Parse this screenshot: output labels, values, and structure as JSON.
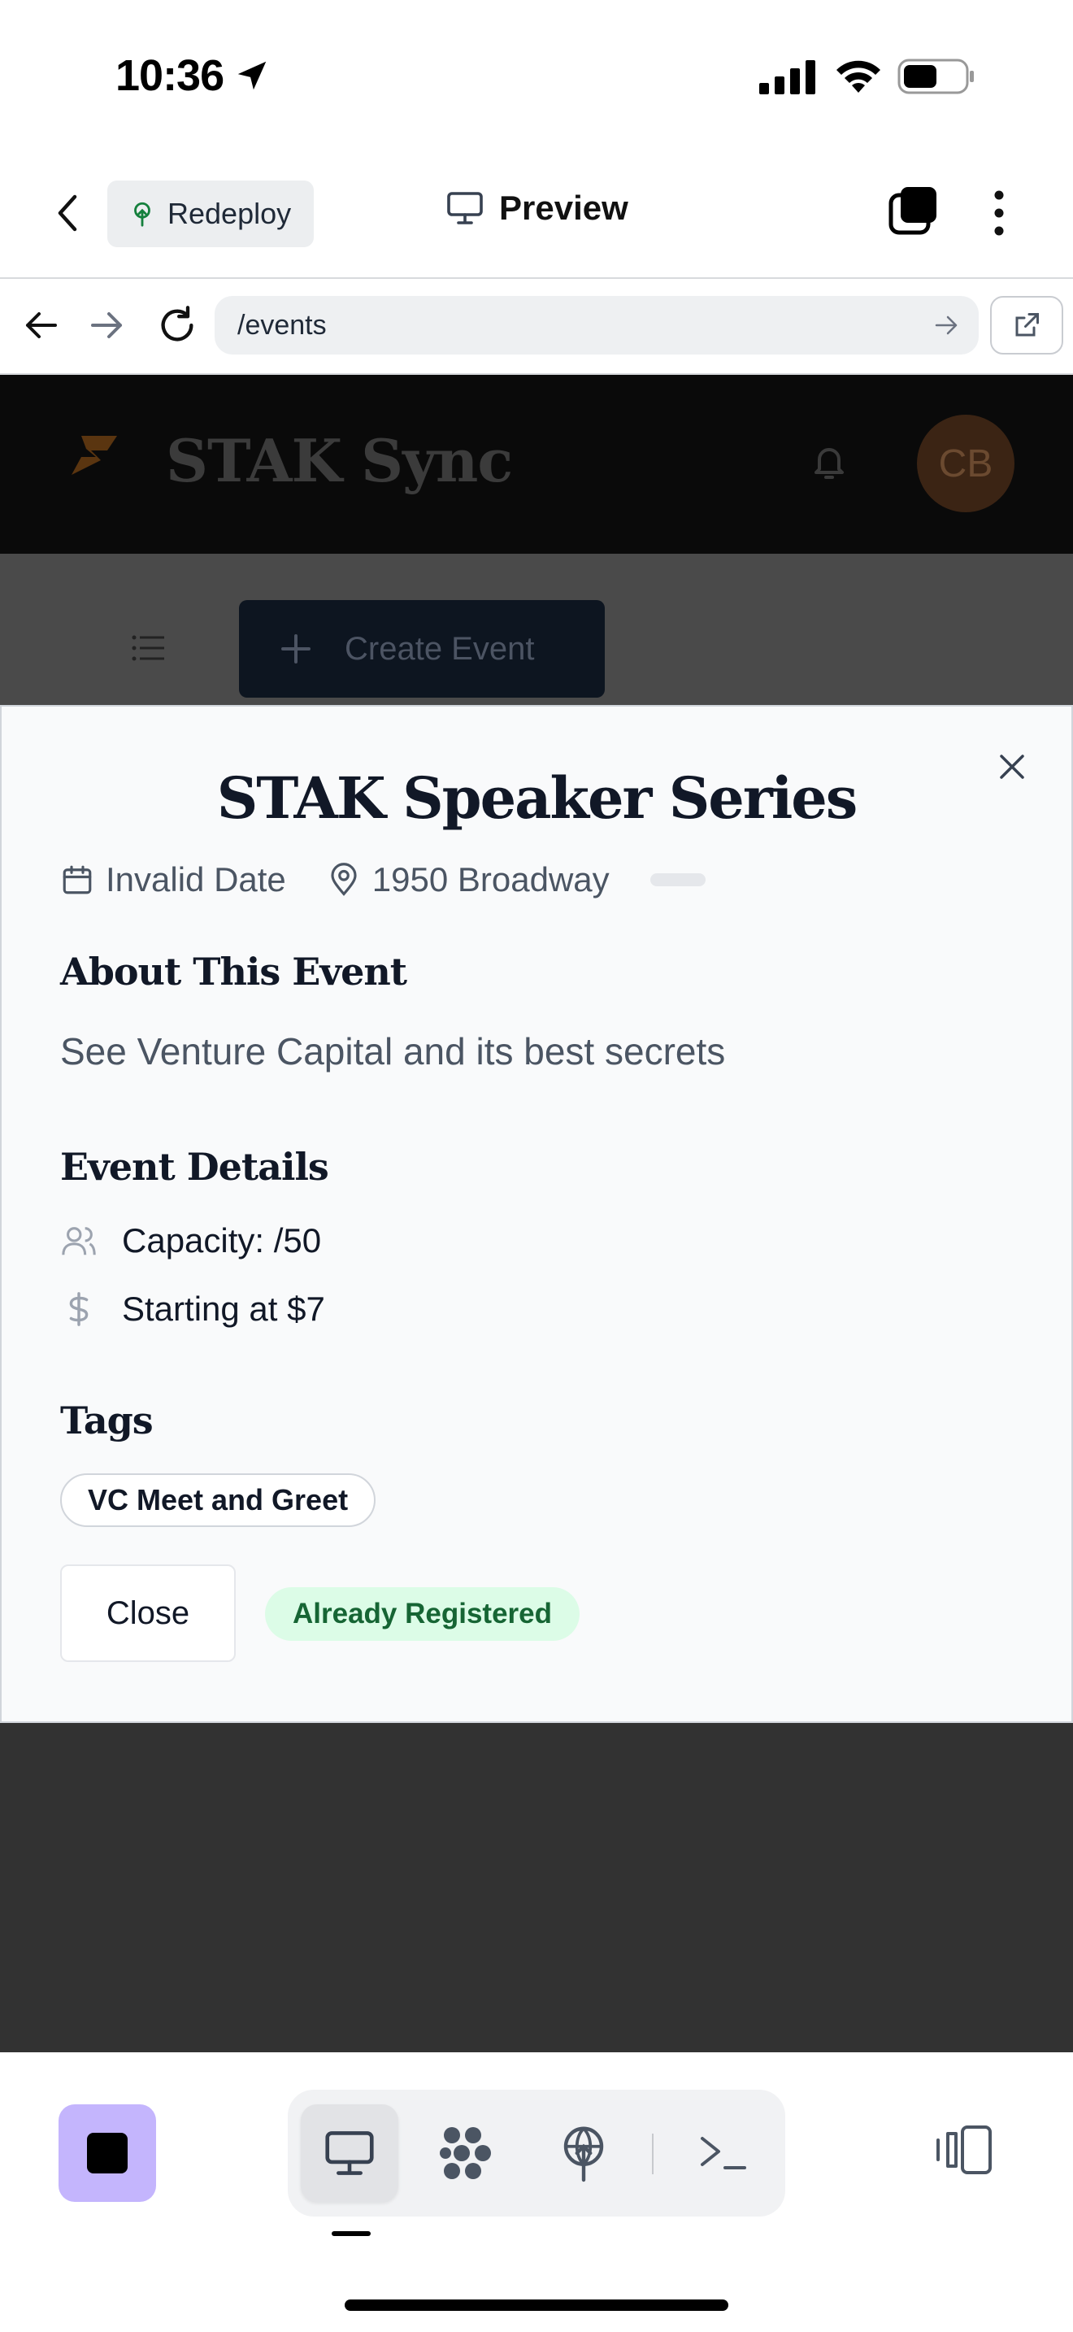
{
  "status_bar": {
    "time": "10:36"
  },
  "top_bar": {
    "redeploy_label": "Redeploy",
    "title": "Preview"
  },
  "address_bar": {
    "url": "/events"
  },
  "app": {
    "title": "STAK Sync",
    "avatar_initials": "CB",
    "create_event_label": "Create Event"
  },
  "modal": {
    "title": "STAK Speaker Series",
    "date": "Invalid Date",
    "location": "1950 Broadway",
    "about_heading": "About This Event",
    "about_text": "See Venture Capital and its best secrets",
    "details_heading": "Event Details",
    "capacity": "Capacity: /50",
    "price": "Starting at $7",
    "tags_heading": "Tags",
    "tags": [
      "VC Meet and Greet"
    ],
    "close_label": "Close",
    "registered_label": "Already Registered"
  },
  "colors": {
    "accent_purple": "#c4b5fd",
    "registered_bg": "#dcfce7",
    "registered_text": "#166534",
    "redeploy_icon": "#15803d"
  },
  "icons": [
    "location-arrow-icon",
    "signal-icon",
    "wifi-icon",
    "battery-icon",
    "back-chevron-icon",
    "tree-icon",
    "monitor-icon",
    "tabs-icon",
    "more-vertical-icon",
    "arrow-left-icon",
    "arrow-right-icon",
    "reload-icon",
    "go-arrow-icon",
    "external-link-icon",
    "logo-icon",
    "bell-icon",
    "list-icon",
    "plus-icon",
    "close-icon",
    "calendar-icon",
    "map-pin-icon",
    "users-icon",
    "dollar-icon",
    "stop-icon",
    "desktop-icon",
    "packages-icon",
    "deploy-icon",
    "terminal-icon",
    "split-view-icon"
  ]
}
